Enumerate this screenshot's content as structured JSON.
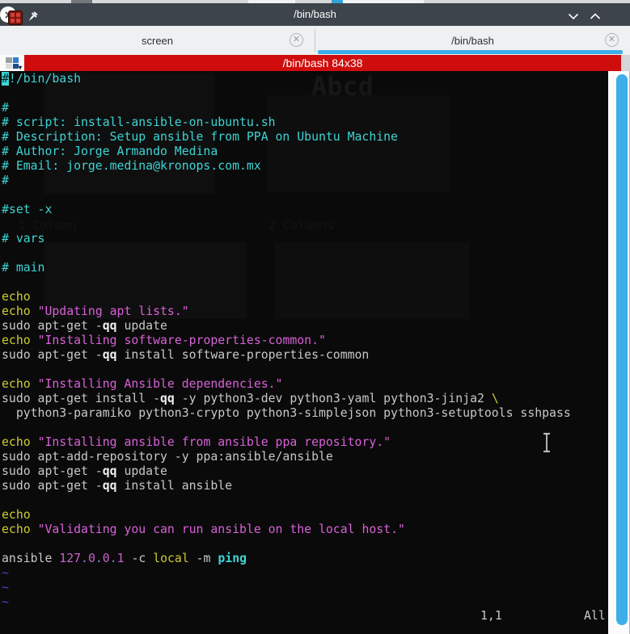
{
  "window": {
    "title": "/bin/bash"
  },
  "titlebar_icons": [
    "app-icon",
    "pin-icon",
    "minimize-chevron-down-icon",
    "maximize-chevron-up-icon",
    "close-circle-x-icon"
  ],
  "tabs": [
    {
      "label": "screen",
      "active": false
    },
    {
      "label": "/bin/bash",
      "active": true
    }
  ],
  "banner": {
    "text": "/bin/bash 84x38"
  },
  "terminal": {
    "status": {
      "cursor_position": "1,1",
      "scroll_indicator": "All"
    },
    "lines": [
      [
        {
          "t": "#",
          "c": "com",
          "cur": true
        },
        {
          "t": "!/bin/bash",
          "c": "com"
        }
      ],
      [],
      [
        {
          "t": "#",
          "c": "com"
        }
      ],
      [
        {
          "t": "# script: install-ansible-on-ubuntu.sh",
          "c": "com"
        }
      ],
      [
        {
          "t": "# Description: Setup ansible from PPA on Ubuntu Machine",
          "c": "com"
        }
      ],
      [
        {
          "t": "# Author: Jorge Armando Medina",
          "c": "com"
        }
      ],
      [
        {
          "t": "# Email: jorge.medina@kronops.com.mx",
          "c": "com"
        }
      ],
      [
        {
          "t": "#",
          "c": "com"
        }
      ],
      [],
      [
        {
          "t": "#set -x",
          "c": "com"
        }
      ],
      [],
      [
        {
          "t": "# vars",
          "c": "com"
        }
      ],
      [],
      [
        {
          "t": "# main",
          "c": "com"
        }
      ],
      [],
      [
        {
          "t": "echo",
          "c": "kw"
        }
      ],
      [
        {
          "t": "echo",
          "c": "kw"
        },
        {
          "t": " "
        },
        {
          "t": "\"Updating apt lists.\"",
          "c": "str"
        }
      ],
      [
        {
          "t": "sudo apt-get -"
        },
        {
          "t": "qq",
          "c": "opt"
        },
        {
          "t": " update"
        }
      ],
      [
        {
          "t": "echo",
          "c": "kw"
        },
        {
          "t": " "
        },
        {
          "t": "\"Installing software-properties-common.\"",
          "c": "str"
        }
      ],
      [
        {
          "t": "sudo apt-get -"
        },
        {
          "t": "qq",
          "c": "opt"
        },
        {
          "t": " install software-properties-common"
        }
      ],
      [],
      [
        {
          "t": "echo",
          "c": "kw"
        },
        {
          "t": " "
        },
        {
          "t": "\"Installing Ansible dependencies.\"",
          "c": "str"
        }
      ],
      [
        {
          "t": "sudo apt-get install -"
        },
        {
          "t": "qq",
          "c": "opt"
        },
        {
          "t": " -y python3-dev python3-yaml python3-jinja2 "
        },
        {
          "t": "\\",
          "c": "kw"
        }
      ],
      [
        {
          "t": "  python3-paramiko python3-crypto python3-simplejson python3-setuptools sshpass"
        }
      ],
      [],
      [
        {
          "t": "echo",
          "c": "kw"
        },
        {
          "t": " "
        },
        {
          "t": "\"Installing ansible from ansible ppa repository.\"",
          "c": "str"
        }
      ],
      [
        {
          "t": "sudo apt-add-repository -y ppa:ansible/ansible"
        }
      ],
      [
        {
          "t": "sudo apt-get -"
        },
        {
          "t": "qq",
          "c": "opt"
        },
        {
          "t": " update"
        }
      ],
      [
        {
          "t": "sudo apt-get -"
        },
        {
          "t": "qq",
          "c": "opt"
        },
        {
          "t": " install ansible"
        }
      ],
      [],
      [
        {
          "t": "echo",
          "c": "kw"
        }
      ],
      [
        {
          "t": "echo",
          "c": "kw"
        },
        {
          "t": " "
        },
        {
          "t": "\"Validating you can run ansible on the local host.\"",
          "c": "str"
        }
      ],
      [],
      [
        {
          "t": "ansible "
        },
        {
          "t": "127",
          "c": "num"
        },
        {
          "t": ".",
          "c": "dot"
        },
        {
          "t": "0",
          "c": "num"
        },
        {
          "t": ".",
          "c": "dot"
        },
        {
          "t": "0",
          "c": "num"
        },
        {
          "t": ".",
          "c": "dot"
        },
        {
          "t": "1",
          "c": "num"
        },
        {
          "t": " -c "
        },
        {
          "t": "local",
          "c": "kw"
        },
        {
          "t": " -m "
        },
        {
          "t": "ping",
          "c": "png"
        }
      ],
      [
        {
          "t": "~",
          "c": "tld"
        }
      ],
      [
        {
          "t": "~",
          "c": "tld"
        }
      ],
      [
        {
          "t": "~",
          "c": "tld"
        }
      ]
    ]
  },
  "background_ghosts": {
    "abcd": "Abcd",
    "col1": "1 Column",
    "col2": "2 Columns"
  },
  "palette": {
    "titlebar": "#3e444b",
    "tabbar": "#eef0f1",
    "accent": "#3daee9",
    "banner_red": "#cf0d0d",
    "terminal_bg": "#0a0a0a",
    "comment": "#3ed4d4",
    "keyword": "#cecb35",
    "string": "#d861d8",
    "plain": "#c8c8c8",
    "optbold": "#f0f0f0",
    "number": "#cb60cb",
    "ipdot": "#8585dd",
    "tilde": "#4747cf"
  }
}
